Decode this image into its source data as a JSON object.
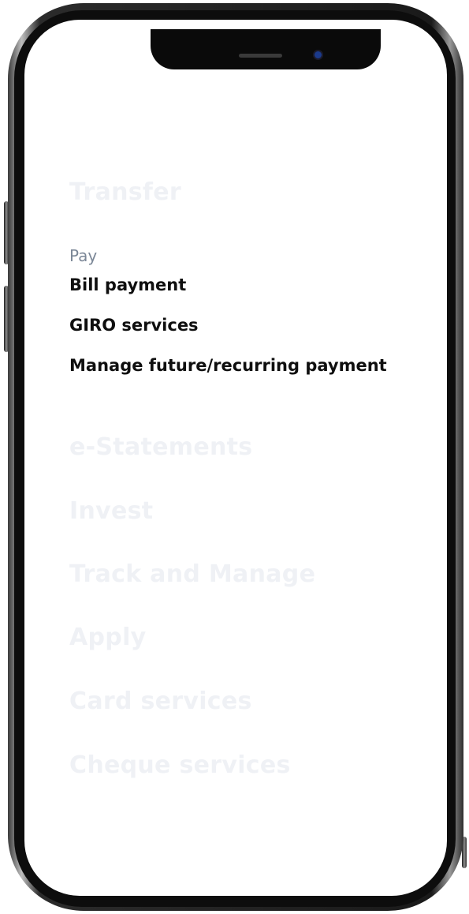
{
  "menu": {
    "transfer": "Transfer",
    "pay": {
      "label": "Pay",
      "items": [
        "Bill payment",
        "GIRO services",
        "Manage future/recurring payment"
      ]
    },
    "e_statements": "e-Statements",
    "invest": "Invest",
    "track_and_manage": "Track and Manage",
    "apply": "Apply",
    "card_services": "Card services",
    "cheque_services": "Cheque services"
  },
  "colors": {
    "faded_text": "#eff1f5",
    "section_label": "#7b8797",
    "active_text": "#0f0f0f",
    "camera": "#1b3a8c"
  },
  "icons": [
    "front-camera-icon",
    "speaker-grille-icon"
  ]
}
